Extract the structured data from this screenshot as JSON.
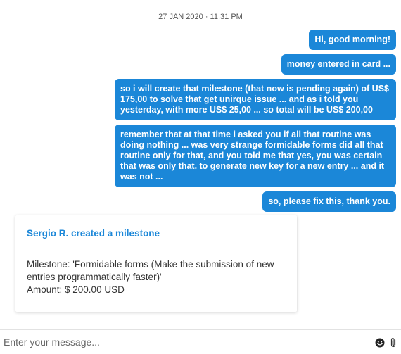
{
  "conversation": {
    "timestamp": "27 JAN 2020 · 11:31 PM",
    "messages": [
      {
        "text": "Hi, good morning!"
      },
      {
        "text": "money entered in card ..."
      },
      {
        "text": "so i will create that milestone (that now is pending again) of US$ 175,00 to solve that get unirque issue ... and as i told you yesterday, with more US$ 25,00 ... so total will be US$ 200,00"
      },
      {
        "text": "remember that at that time i asked you if all that routine was doing nothing ... was very strange formidable forms did all that routine only for that, and you told me that yes, you was certain that was only that. to generate new key for a new entry ... and it was not ..."
      },
      {
        "text": "so, please fix this, thank you."
      }
    ]
  },
  "milestone_card": {
    "title": "Sergio R. created a milestone",
    "milestone_line": "Milestone: 'Formidable forms (Make the submission of new entries programmatically faster)'",
    "amount_line": "Amount: $ 200.00 USD"
  },
  "composer": {
    "placeholder": "Enter your message...",
    "icons": [
      "emoji-icon",
      "paperclip-icon"
    ]
  },
  "colors": {
    "accent": "#1b87d8",
    "bubble_text": "#ffffff"
  }
}
